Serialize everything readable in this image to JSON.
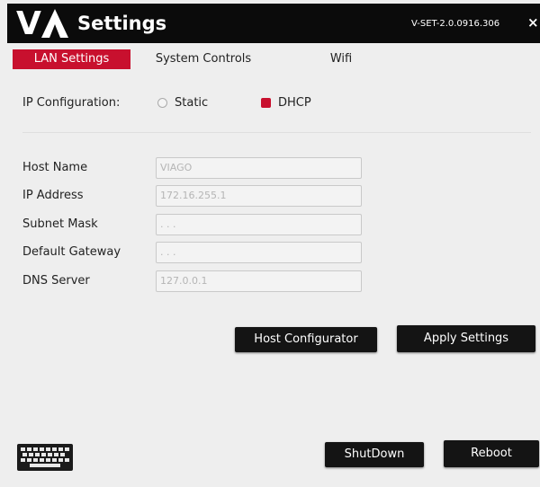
{
  "window": {
    "logo_v": "V",
    "title": "Settings",
    "version": "V-SET-2.0.0916.306",
    "close_glyph": "×"
  },
  "tabs": [
    {
      "label": "LAN Settings",
      "active": true
    },
    {
      "label": "System Controls",
      "active": false
    },
    {
      "label": "Wifi",
      "active": false
    }
  ],
  "ip_configuration": {
    "label": "IP Configuration:",
    "options": [
      {
        "label": "Static",
        "selected": false
      },
      {
        "label": "DHCP",
        "selected": true
      }
    ]
  },
  "fields": [
    {
      "label": "Host Name",
      "value": "VIAGO"
    },
    {
      "label": "IP Address",
      "value": "172.16.255.1"
    },
    {
      "label": "Subnet Mask",
      "value": ". . ."
    },
    {
      "label": "Default Gateway",
      "value": ". . ."
    },
    {
      "label": "DNS Server",
      "value": "127.0.0.1"
    }
  ],
  "buttons": {
    "host_configurator": "Host Configurator",
    "apply_settings": "Apply Settings",
    "shutdown": "ShutDown",
    "reboot": "Reboot"
  },
  "icons": {
    "keyboard": "keyboard-icon"
  },
  "colors": {
    "accent": "#c8102e",
    "titlebar": "#0b0b0b",
    "button": "#141414"
  }
}
